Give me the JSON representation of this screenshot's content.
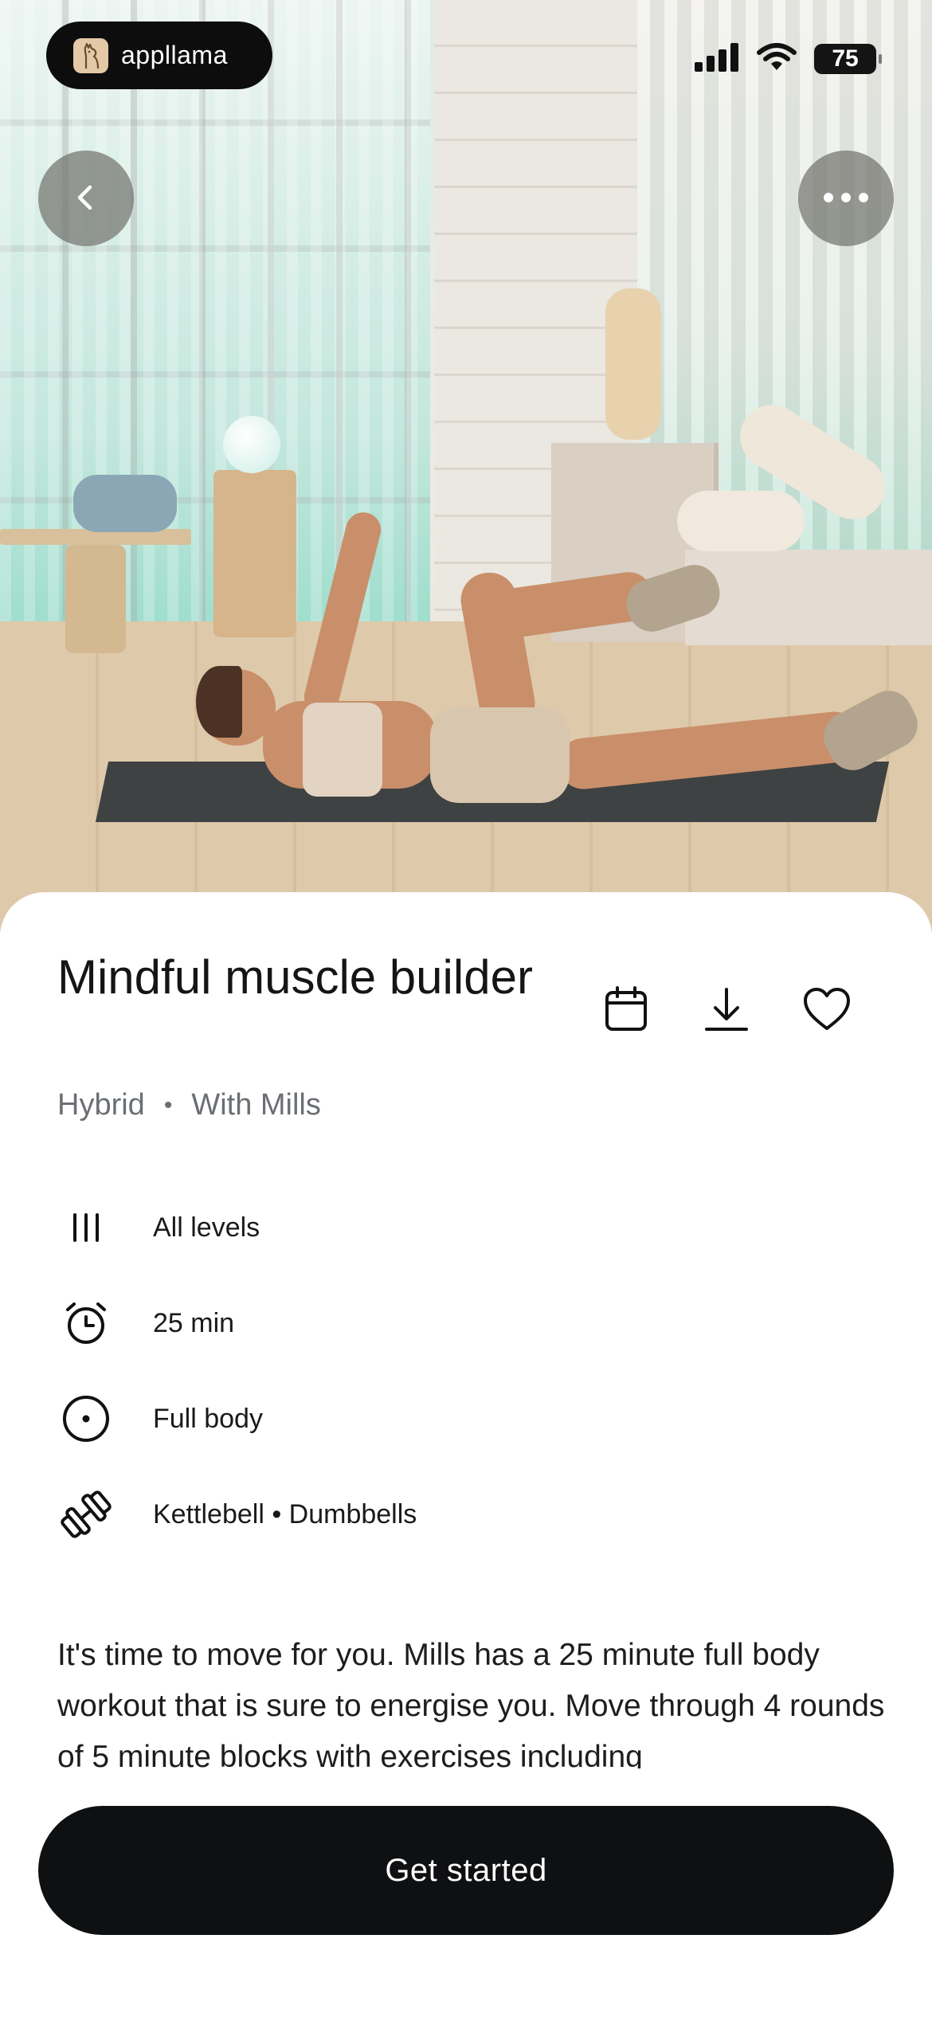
{
  "brand": {
    "name": "appllama",
    "logo_icon": "llama-icon"
  },
  "status_bar": {
    "battery": "75",
    "signal_icon": "cellular-signal-icon",
    "wifi_icon": "wifi-icon"
  },
  "nav": {
    "back_icon": "chevron-left-icon",
    "more_icon": "more-horizontal-icon"
  },
  "workout": {
    "title": "Mindful muscle builder",
    "category": "Hybrid",
    "separator": "•",
    "instructor": "With Mills",
    "actions": [
      {
        "name": "schedule",
        "icon": "calendar-icon"
      },
      {
        "name": "download",
        "icon": "download-icon"
      },
      {
        "name": "favorite",
        "icon": "heart-icon"
      }
    ],
    "details": [
      {
        "icon": "levels-icon",
        "label": "All levels"
      },
      {
        "icon": "alarm-clock-icon",
        "label": "25 min"
      },
      {
        "icon": "target-icon",
        "label": "Full body"
      },
      {
        "icon": "dumbbell-icon",
        "label": "Kettlebell • Dumbbells"
      }
    ],
    "description": "It's time to move for you. Mills has a 25 minute full body workout that is sure to energise you. Move through 4 rounds of 5 minute blocks with exercises including"
  },
  "cta": {
    "label": "Get started"
  }
}
